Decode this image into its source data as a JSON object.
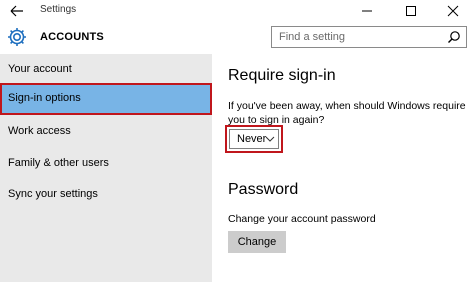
{
  "window": {
    "title": "Settings",
    "controls": {
      "minimize_icon": "minimize-icon",
      "maximize_icon": "maximize-icon",
      "close_icon": "close-icon"
    }
  },
  "header": {
    "title": "ACCOUNTS",
    "search_placeholder": "Find a setting"
  },
  "sidebar": {
    "items": [
      {
        "label": "Your account",
        "selected": false
      },
      {
        "label": "Sign-in options",
        "selected": true
      },
      {
        "label": "Work access",
        "selected": false
      },
      {
        "label": "Family & other users",
        "selected": false
      },
      {
        "label": "Sync your settings",
        "selected": false
      }
    ]
  },
  "main": {
    "require_signin": {
      "heading": "Require sign-in",
      "description": "If you've been away, when should Windows require you to sign in again?",
      "dropdown_value": "Never"
    },
    "password": {
      "heading": "Password",
      "description": "Change your account password",
      "button_label": "Change"
    }
  },
  "colors": {
    "selected_bg": "#78b4e6",
    "highlight_border": "#c0161c",
    "sidebar_bg": "#e9e9e9",
    "button_bg": "#cccccc"
  }
}
